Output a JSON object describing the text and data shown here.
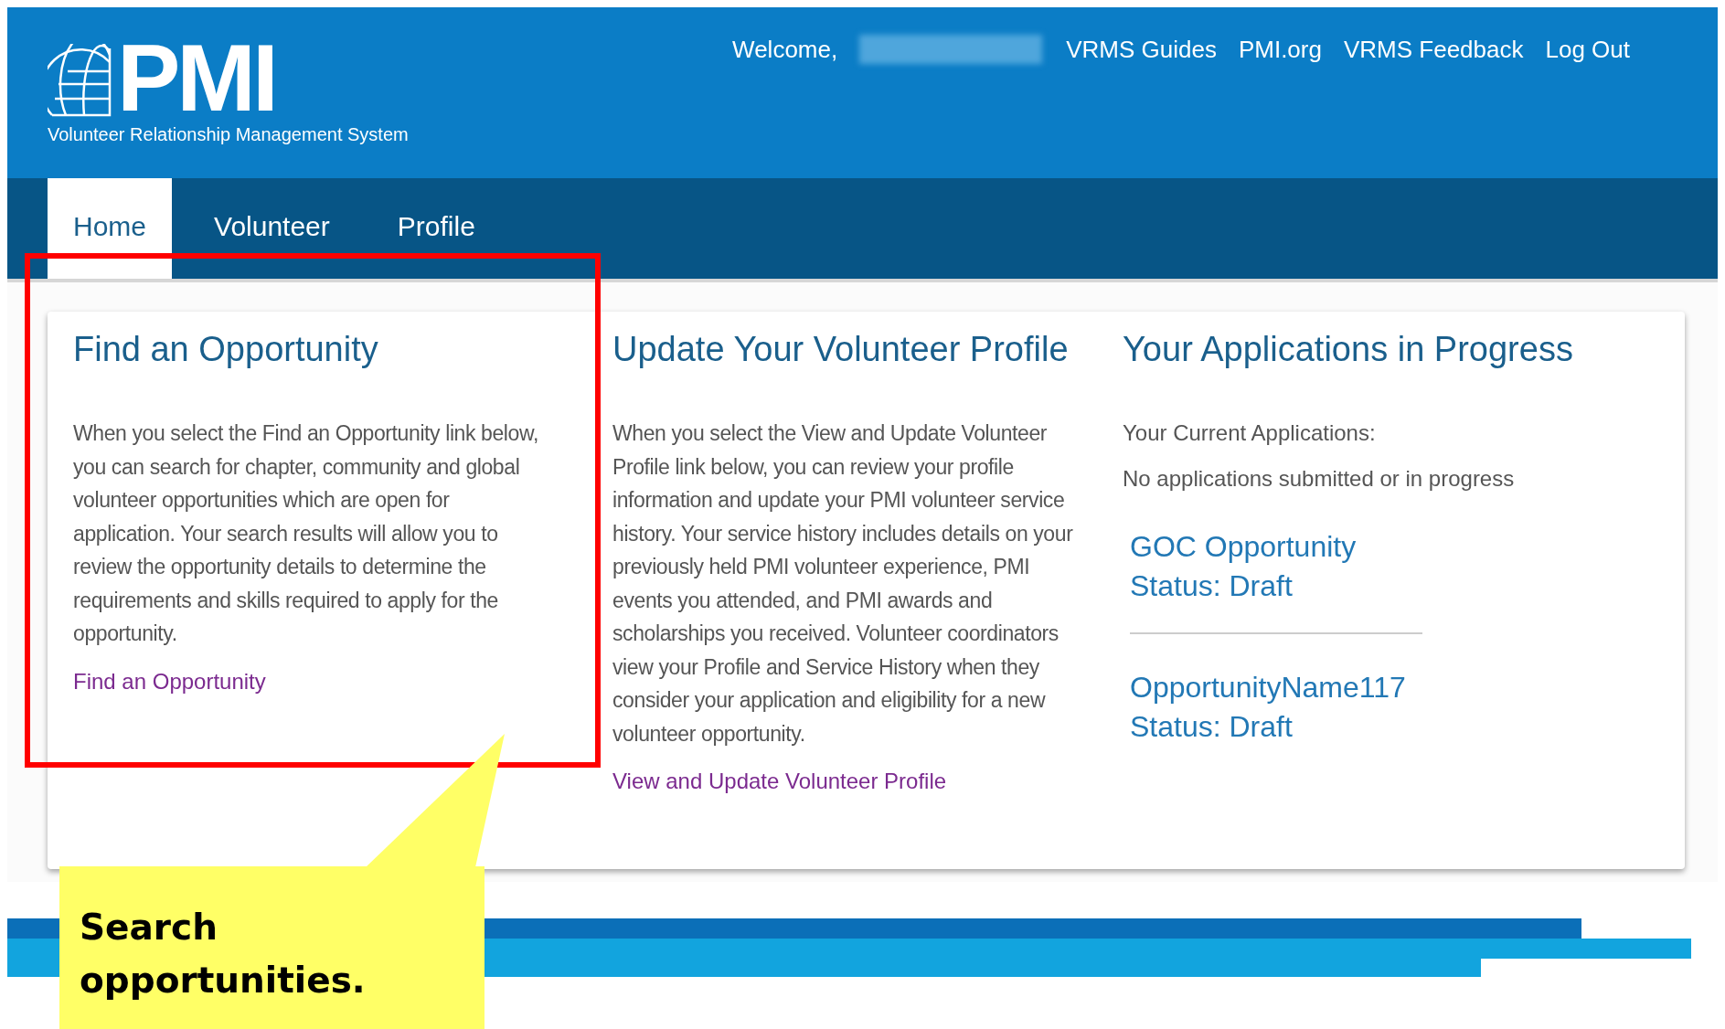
{
  "header": {
    "logo": {
      "mark": "PMI",
      "tagline": "Volunteer Relationship Management System"
    },
    "welcome": "Welcome,",
    "links": [
      "VRMS Guides",
      "PMI.org",
      "VRMS Feedback",
      "Log Out"
    ]
  },
  "tabs": [
    {
      "label": "Home",
      "selected": true
    },
    {
      "label": "Volunteer",
      "selected": false
    },
    {
      "label": "Profile",
      "selected": false
    }
  ],
  "columns": [
    {
      "kind": "info",
      "title": "Find an Opportunity",
      "text": "When you select the Find an Opportunity link below, you can search for chapter, community and global volunteer opportunities which are open for application. Your search results will allow you to review the opportunity details to determine the requirements and skills required to apply for the opportunity.",
      "link": "Find an Opportunity"
    },
    {
      "kind": "info",
      "title": "Update Your Volunteer Profile",
      "text": "When you select the View and Update Volunteer Profile link below, you can review your profile information and update your PMI volunteer service history. Your service history includes details on your previously held PMI volunteer experience, PMI events you attended, and PMI awards and scholarships you received. Volunteer coordinators view your Profile and Service History when they consider your application and eligibility for a new volunteer opportunity.",
      "link": "View and Update Volunteer Profile"
    },
    {
      "kind": "applications",
      "title": "Your Applications in Progress",
      "subtitle": "Your Current Applications:",
      "note": "No applications submitted or in progress",
      "applications": [
        {
          "name": "GOC Opportunity",
          "status": "Status: Draft"
        },
        {
          "name": "OpportunityName117",
          "status": "Status: Draft"
        }
      ]
    }
  ],
  "annotation": {
    "text": "Search opportunities."
  }
}
